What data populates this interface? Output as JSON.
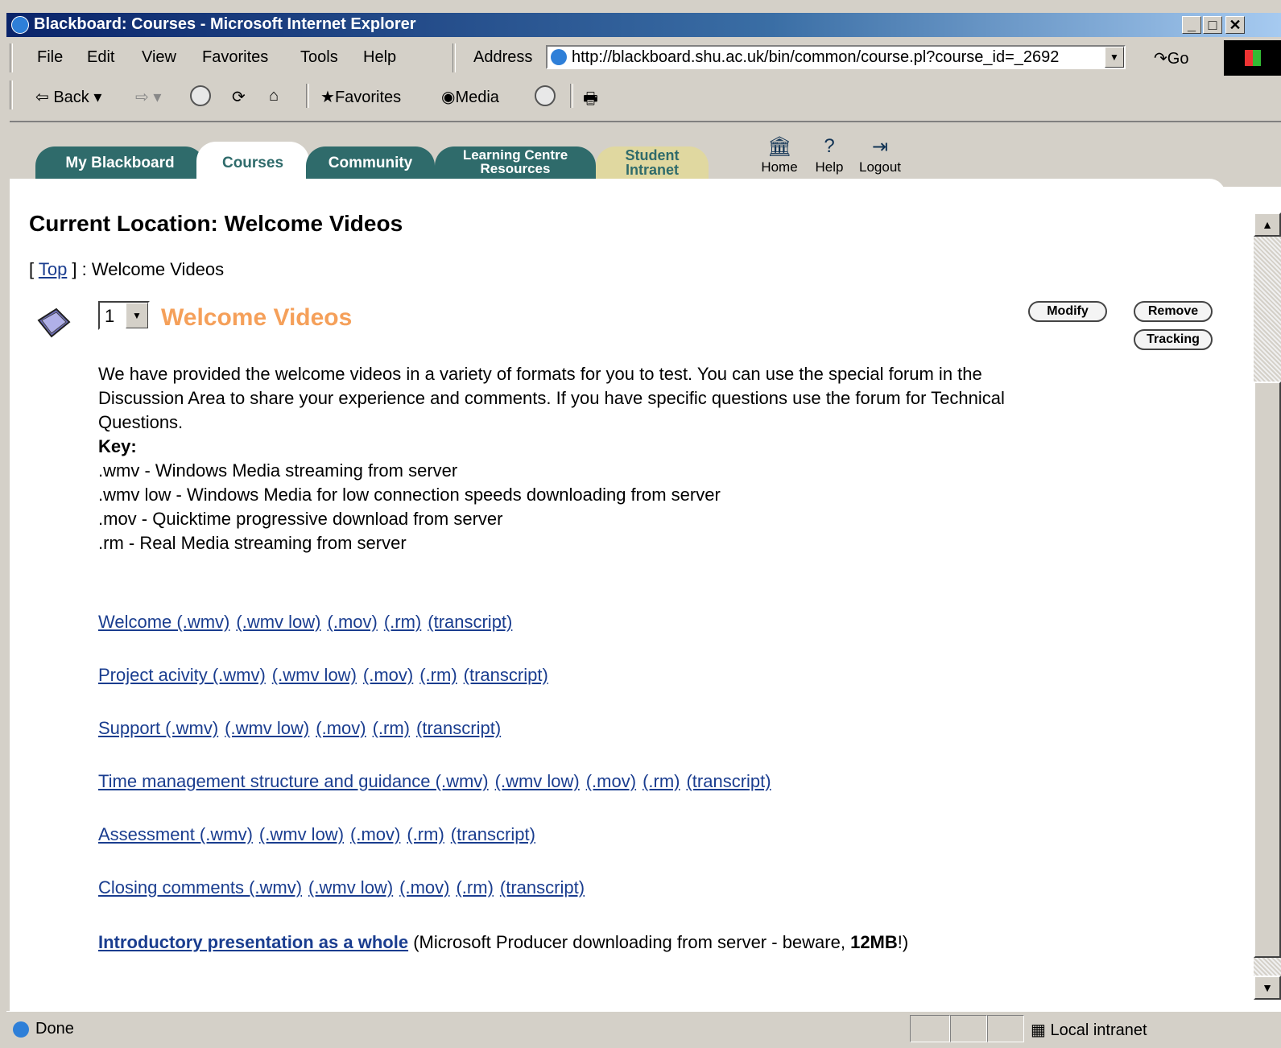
{
  "window": {
    "title": "Blackboard: Courses - Microsoft Internet Explorer"
  },
  "menu": {
    "items": [
      "File",
      "Edit",
      "View",
      "Favorites",
      "Tools",
      "Help"
    ]
  },
  "address": {
    "label": "Address",
    "url": "http://blackboard.shu.ac.uk/bin/common/course.pl?course_id=_2692",
    "go": "Go"
  },
  "toolbar": {
    "back": "Back",
    "favorites": "Favorites",
    "media": "Media"
  },
  "nav": {
    "tabs": [
      {
        "l1": "My Blackboard",
        "l2": ""
      },
      {
        "l1": "Courses",
        "l2": ""
      },
      {
        "l1": "Community",
        "l2": ""
      },
      {
        "l1": "Learning Centre",
        "l2": "Resources"
      },
      {
        "l1": "Student",
        "l2": "Intranet"
      }
    ],
    "home": "Home",
    "help": "Help",
    "logout": "Logout"
  },
  "page": {
    "heading": "Current Location: Welcome Videos",
    "crumb_open": "[ ",
    "crumb_top": "Top",
    "crumb_rest": " ] : Welcome Videos",
    "item": {
      "order": "1",
      "title": "Welcome Videos",
      "modify": "Modify",
      "remove": "Remove",
      "tracking": "Tracking"
    },
    "intro": "We have provided the welcome videos in a variety of formats for you to test. You can use the special forum in the Discussion Area to share your experience and comments. If you have specific questions use the forum for Technical Questions.",
    "key_title": "Key:",
    "key_lines": [
      ".wmv - Windows Media streaming from server",
      ".wmv low - Windows Media for low connection speeds downloading from server",
      ".mov - Quicktime progressive download from server",
      ".rm - Real Media streaming from server"
    ],
    "videos": [
      {
        "main": "Welcome (.wmv)",
        "wmvlow": "(.wmv low)",
        "mov": "(.mov)",
        "rm": "(.rm)",
        "transcript": "(transcript)"
      },
      {
        "main": "Project acivity (.wmv)",
        "wmvlow": "(.wmv low)",
        "mov": "(.mov)",
        "rm": "(.rm)",
        "transcript": "(transcript)"
      },
      {
        "main": "Support (.wmv)",
        "wmvlow": "(.wmv low)",
        "mov": "(.mov)",
        "rm": "(.rm)",
        "transcript": "(transcript)"
      },
      {
        "main": "Time management structure and guidance (.wmv)",
        "wmvlow": "(.wmv low)",
        "mov": "(.mov)",
        "rm": "(.rm)",
        "transcript": "(transcript)"
      },
      {
        "main": "Assessment (.wmv)",
        "wmvlow": "(.wmv low)",
        "mov": "(.mov)",
        "rm": "(.rm)",
        "transcript": "(transcript)"
      },
      {
        "main": "Closing comments (.wmv)",
        "wmvlow": "(.wmv low)",
        "mov": "(.mov)",
        "rm": "(.rm)",
        "transcript": "(transcript)"
      }
    ],
    "intro_pres_link": "Introductory presentation as a whole",
    "intro_pres_note": " (Microsoft Producer downloading from server - beware, ",
    "intro_pres_size": "12MB",
    "intro_pres_end": "!)"
  },
  "status": {
    "text": "Done",
    "zone": "Local intranet"
  },
  "colors": {
    "tab": "#2f6b6b",
    "tab_tan": "#e0d8a0",
    "item_title": "#f5a05a",
    "link": "#1a3d8f"
  }
}
